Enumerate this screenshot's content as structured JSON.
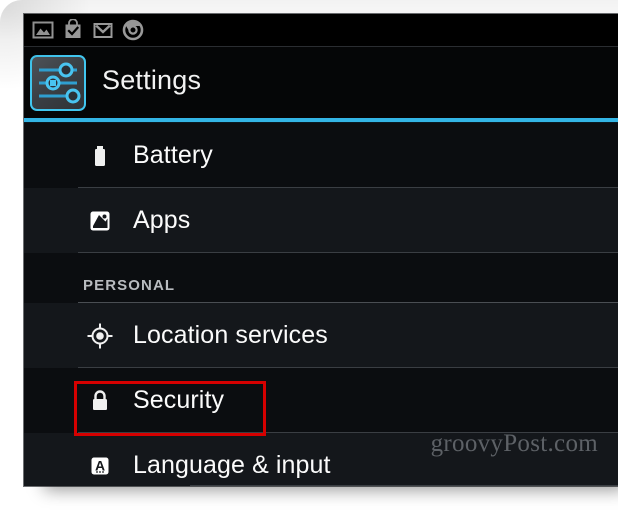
{
  "window": {
    "frame_background": "#ffffff",
    "screen_background": "#080a0c"
  },
  "statusbar": {
    "background": "#000000",
    "icon_color": "#9a9a9a",
    "icons": [
      {
        "name": "gallery-photo-icon",
        "label": "Gallery"
      },
      {
        "name": "play-store-bag-check-icon",
        "label": "Play Store"
      },
      {
        "name": "gmail-envelope-icon",
        "label": "Gmail"
      },
      {
        "name": "chrome-browser-icon",
        "label": "Chrome"
      }
    ]
  },
  "header": {
    "title": "Settings",
    "app_icon": "settings-sliders-icon",
    "accent_color": "#33b5e5",
    "icon_border_color": "#41c6ef"
  },
  "list": {
    "items": [
      {
        "type": "row",
        "icon": "battery-icon",
        "label": "Battery",
        "tint": false
      },
      {
        "type": "row",
        "icon": "apps-image-icon",
        "label": "Apps",
        "tint": true
      },
      {
        "type": "section",
        "icon": "",
        "label": "PERSONAL",
        "tint": false
      },
      {
        "type": "row",
        "icon": "location-crosshair-icon",
        "label": "Location services",
        "tint": true
      },
      {
        "type": "row",
        "icon": "lock-padlock-icon",
        "label": "Security",
        "tint": false
      },
      {
        "type": "row",
        "icon": "language-a-icon",
        "label": "Language & input",
        "tint": true
      }
    ]
  },
  "annotation": {
    "target_label": "Security",
    "box_color": "#d60000",
    "box_style": "rectangle-outline"
  },
  "watermark": {
    "text": "groovyPost.com",
    "color": "#5d6166"
  }
}
